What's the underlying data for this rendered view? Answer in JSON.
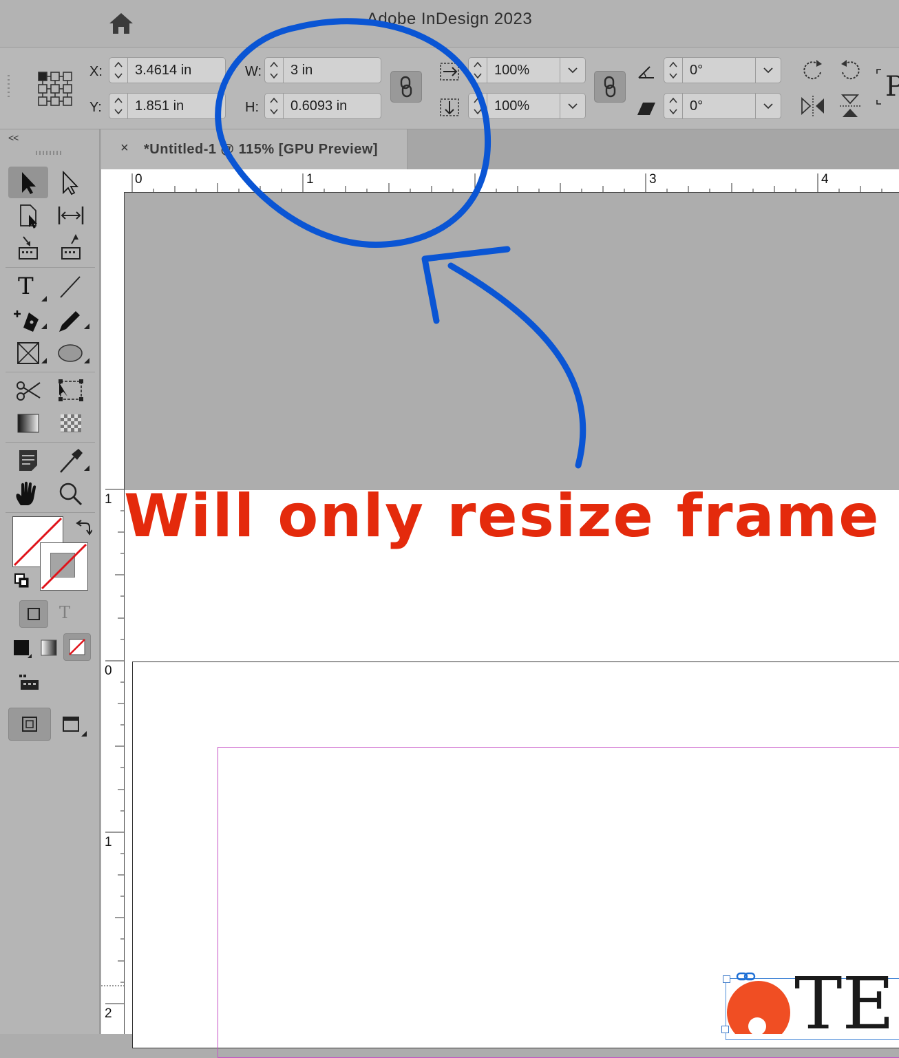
{
  "app": {
    "title": "Adobe InDesign 2023"
  },
  "control_panel": {
    "x_label": "X:",
    "x_value": "3.4614 in",
    "y_label": "Y:",
    "y_value": "1.851 in",
    "w_label": "W:",
    "w_value": "3 in",
    "h_label": "H:",
    "h_value": "0.6093 in",
    "scale_x_value": "100%",
    "scale_y_value": "100%",
    "rotation_value": "0°",
    "shear_value": "0°",
    "cutoff_glyph": "P"
  },
  "document_tab": {
    "close_glyph": "×",
    "name": "*Untitled-1 @ 115% [GPU Preview]"
  },
  "tools_panel": {
    "collapse_glyph": "<<",
    "type_glyph": "T"
  },
  "rulers": {
    "horizontal": [
      "0",
      "1",
      "3",
      "4"
    ],
    "vertical": [
      "1",
      "0",
      "1",
      "2"
    ]
  },
  "annotation": {
    "text": "Will only resize frame",
    "color": "#e42a0c",
    "ink_color": "#0a55d4"
  },
  "page_content": {
    "logo_text": "TE",
    "logo_color": "#f04e23"
  }
}
